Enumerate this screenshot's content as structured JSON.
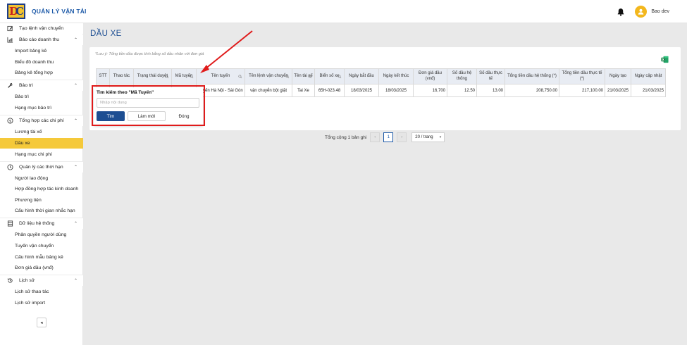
{
  "header": {
    "app_title": "QUẢN LÝ VẬN TẢI",
    "user_name": "Bao dev",
    "icons": [
      "logo-icon",
      "bell-icon",
      "avatar-icon"
    ]
  },
  "sidebar": {
    "items": [
      {
        "label": "Tạo lệnh vận chuyển",
        "type": "section",
        "icon": "edit-icon"
      },
      {
        "label": "Báo cáo doanh thu",
        "type": "section",
        "icon": "chart-icon",
        "expanded": true
      },
      {
        "label": "Import bảng kê",
        "type": "sub"
      },
      {
        "label": "Biểu đồ doanh thu",
        "type": "sub"
      },
      {
        "label": "Bảng kê tổng hợp",
        "type": "sub"
      },
      {
        "label": "Bảo trì",
        "type": "section",
        "icon": "wrench-icon",
        "expanded": true
      },
      {
        "label": "Bảo trì",
        "type": "sub"
      },
      {
        "label": "Hạng mục bảo trì",
        "type": "sub"
      },
      {
        "label": "Tổng hợp các chi phí",
        "type": "section",
        "icon": "money-icon",
        "expanded": true
      },
      {
        "label": "Lương tài xế",
        "type": "sub"
      },
      {
        "label": "Dầu xe",
        "type": "sub",
        "active": true
      },
      {
        "label": "Hạng mục chi phí",
        "type": "sub"
      },
      {
        "label": "Quản lý các thời hạn",
        "type": "section",
        "icon": "clock-icon",
        "expanded": true
      },
      {
        "label": "Người lao động",
        "type": "sub"
      },
      {
        "label": "Hợp đồng hợp tác kinh doanh",
        "type": "sub"
      },
      {
        "label": "Phương tiện",
        "type": "sub"
      },
      {
        "label": "Cấu hình thời gian nhắc hạn",
        "type": "sub"
      },
      {
        "label": "Dữ liệu hệ thống",
        "type": "section",
        "icon": "database-icon",
        "expanded": true
      },
      {
        "label": "Phân quyền người dùng",
        "type": "sub"
      },
      {
        "label": "Tuyến vận chuyển",
        "type": "sub"
      },
      {
        "label": "Cấu hình mẫu bảng kê",
        "type": "sub"
      },
      {
        "label": "Đơn giá dầu (vnđ)",
        "type": "sub"
      },
      {
        "label": "Lịch sử",
        "type": "section",
        "icon": "history-icon",
        "expanded": true
      },
      {
        "label": "Lịch sử thao tác",
        "type": "sub"
      },
      {
        "label": "Lịch sử import",
        "type": "sub"
      }
    ],
    "collapse_label": "◂"
  },
  "main": {
    "page_title": "DẦU XE",
    "note": "*Lưu ý: Tổng tiền dầu được tính bằng số dầu nhân với đơn giá",
    "table": {
      "columns": [
        {
          "label": "STT",
          "filter": false
        },
        {
          "label": "Thao tác",
          "filter": false
        },
        {
          "label": "Trạng thái duyệt",
          "filter": true
        },
        {
          "label": "Mã tuyến",
          "filter": true
        },
        {
          "label": "Tên tuyến",
          "filter": true
        },
        {
          "label": "Tên lệnh vận chuyển",
          "filter": true
        },
        {
          "label": "Tên tài xế",
          "filter": true
        },
        {
          "label": "Biển số xe",
          "filter": true
        },
        {
          "label": "Ngày bắt đầu",
          "filter": false
        },
        {
          "label": "Ngày kết thúc",
          "filter": false
        },
        {
          "label": "Đơn giá dầu (vnđ)",
          "filter": false
        },
        {
          "label": "Số dầu hệ thống",
          "filter": false
        },
        {
          "label": "Số dầu thực tế",
          "filter": false
        },
        {
          "label": "Tổng tiền dầu hệ thống (*)",
          "filter": false
        },
        {
          "label": "Tổng tiền dầu thực tế (*)",
          "filter": false
        },
        {
          "label": "Ngày tạo",
          "filter": false
        },
        {
          "label": "Ngày cập nhật",
          "filter": false
        }
      ],
      "rows": [
        [
          "",
          "",
          "",
          "",
          "Tuyến Hà Nội - Sài Gòn",
          "vận chuyển bột giặt",
          "Tai Xe",
          "65H-023.48",
          "18/03/2025",
          "18/03/2025",
          "16,700",
          "12.50",
          "13.00",
          "208,750.00",
          "217,100.00",
          "21/03/2025",
          "21/03/2025"
        ]
      ]
    },
    "pagination": {
      "total": "Tổng cộng 1 bản ghi",
      "prev": "‹",
      "current_page": "1",
      "next": "›",
      "page_size": "20 / trang"
    },
    "filter_popup": {
      "title": "Tìm kiếm theo \"Mã Tuyến\"",
      "placeholder": "Nhập nội dung",
      "search_label": "Tìm",
      "reset_label": "Làm mới",
      "close_label": "Đóng"
    }
  },
  "colors": {
    "accent": "#1d4e92",
    "active_menu": "#f5c93a",
    "annotation": "#e01b1b"
  }
}
